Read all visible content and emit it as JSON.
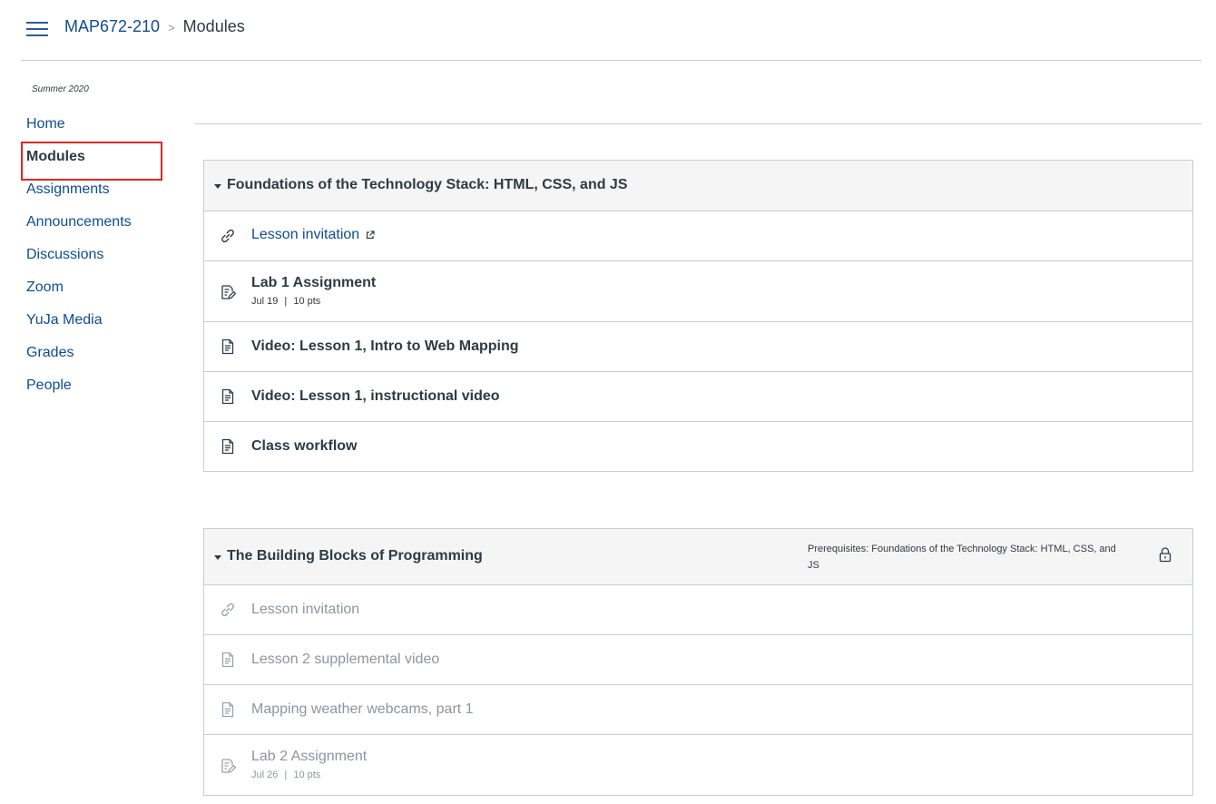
{
  "header": {
    "course": "MAP672-210",
    "separator": ">",
    "current": "Modules",
    "menu_icon": "hamburger-icon"
  },
  "sidebar": {
    "term": "Summer 2020",
    "items": [
      {
        "label": "Home"
      },
      {
        "label": "Modules",
        "active": true
      },
      {
        "label": "Assignments"
      },
      {
        "label": "Announcements"
      },
      {
        "label": "Discussions"
      },
      {
        "label": "Zoom"
      },
      {
        "label": "YuJa Media"
      },
      {
        "label": "Grades"
      },
      {
        "label": "People"
      }
    ]
  },
  "modules": [
    {
      "title": "Foundations of the Technology Stack: HTML, CSS, and JS",
      "items": [
        {
          "icon": "link-icon",
          "title": "Lesson invitation",
          "external": true
        },
        {
          "icon": "assignment-icon",
          "title": "Lab 1 Assignment",
          "date": "Jul 19",
          "divider": "|",
          "points": "10 pts"
        },
        {
          "icon": "page-icon",
          "title": "Video: Lesson 1, Intro to Web Mapping"
        },
        {
          "icon": "page-icon",
          "title": "Video: Lesson 1, instructional video"
        },
        {
          "icon": "page-icon",
          "title": "Class workflow"
        }
      ]
    },
    {
      "title": "The Building Blocks of Programming",
      "prerequisites": "Prerequisites: Foundations of the Technology Stack: HTML, CSS, and JS",
      "locked": true,
      "items": [
        {
          "icon": "link-icon",
          "title": "Lesson invitation"
        },
        {
          "icon": "page-icon",
          "title": "Lesson 2 supplemental video"
        },
        {
          "icon": "page-icon",
          "title": "Mapping weather webcams, part 1"
        },
        {
          "icon": "assignment-icon",
          "title": "Lab 2 Assignment",
          "date": "Jul 26",
          "divider": "|",
          "points": "10 pts"
        }
      ]
    }
  ],
  "colors": {
    "link": "#0e4c92",
    "text": "#2d3b45",
    "muted": "#8b969e",
    "border": "#c7cdd1",
    "header_bg": "#f5f5f5",
    "highlight": "#e0261f"
  }
}
